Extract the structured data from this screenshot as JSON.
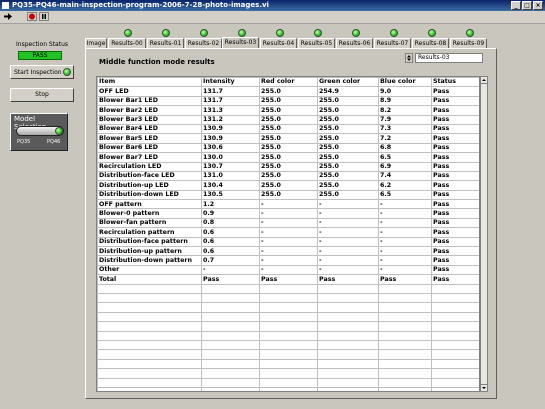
{
  "window": {
    "title": "PQ35-PQ46-main-inspection-program-2006-7-28-photo-images.vi"
  },
  "left_panel": {
    "inspection_status_label": "Inspection Status",
    "inspection_status_value": "PASS",
    "start_button_label": "Start Inspection",
    "stop_button_label": "Stop",
    "model_selection_label": "Model Selection",
    "model_options": [
      "PQ35",
      "PQ46"
    ]
  },
  "tabs": [
    {
      "label": "Image",
      "led": false
    },
    {
      "label": "Results-00",
      "led": true
    },
    {
      "label": "Results-01",
      "led": true
    },
    {
      "label": "Results-02",
      "led": true
    },
    {
      "label": "Results-03",
      "led": true,
      "active": true
    },
    {
      "label": "Results-04",
      "led": true
    },
    {
      "label": "Results-05",
      "led": true
    },
    {
      "label": "Results-06",
      "led": true
    },
    {
      "label": "Results-07",
      "led": true
    },
    {
      "label": "Results-08",
      "led": true
    },
    {
      "label": "Results-09",
      "led": true
    }
  ],
  "results": {
    "title": "Middle function mode results",
    "selector_value": "Results-03",
    "columns": [
      "Item",
      "Intensity",
      "Red color",
      "Green color",
      "Blue color",
      "Status"
    ],
    "rows": [
      [
        "OFF LED",
        "131.7",
        "255.0",
        "254.9",
        "9.0",
        "Pass"
      ],
      [
        "Blower Bar1 LED",
        "131.7",
        "255.0",
        "255.0",
        "8.9",
        "Pass"
      ],
      [
        "Blower Bar2 LED",
        "131.3",
        "255.0",
        "255.0",
        "8.2",
        "Pass"
      ],
      [
        "Blower Bar3 LED",
        "131.2",
        "255.0",
        "255.0",
        "7.9",
        "Pass"
      ],
      [
        "Blower Bar4 LED",
        "130.9",
        "255.0",
        "255.0",
        "7.3",
        "Pass"
      ],
      [
        "Blower Bar5 LED",
        "130.9",
        "255.0",
        "255.0",
        "7.2",
        "Pass"
      ],
      [
        "Blower Bar6 LED",
        "130.6",
        "255.0",
        "255.0",
        "6.8",
        "Pass"
      ],
      [
        "Blower Bar7 LED",
        "130.0",
        "255.0",
        "255.0",
        "6.5",
        "Pass"
      ],
      [
        "Recirculation LED",
        "130.7",
        "255.0",
        "255.0",
        "6.9",
        "Pass"
      ],
      [
        "Distribution-face LED",
        "131.0",
        "255.0",
        "255.0",
        "7.4",
        "Pass"
      ],
      [
        "Distribution-up LED",
        "130.4",
        "255.0",
        "255.0",
        "6.2",
        "Pass"
      ],
      [
        "Distribution-down LED",
        "130.5",
        "255.0",
        "255.0",
        "6.5",
        "Pass"
      ],
      [
        "OFF pattern",
        "1.2",
        "-",
        "-",
        "-",
        "Pass"
      ],
      [
        "Blower-0 pattern",
        "0.9",
        "-",
        "-",
        "-",
        "Pass"
      ],
      [
        "Blower-fan pattern",
        "0.8",
        "-",
        "-",
        "-",
        "Pass"
      ],
      [
        "Recirculation pattern",
        "0.6",
        "-",
        "-",
        "-",
        "Pass"
      ],
      [
        "Distribution-face pattern",
        "0.6",
        "-",
        "-",
        "-",
        "Pass"
      ],
      [
        "Distribution-up pattern",
        "0.6",
        "-",
        "-",
        "-",
        "Pass"
      ],
      [
        "Distribution-down pattern",
        "0.7",
        "-",
        "-",
        "-",
        "Pass"
      ],
      [
        "Other",
        "-",
        "-",
        "-",
        "-",
        "Pass"
      ],
      [
        "Total",
        "Pass",
        "Pass",
        "Pass",
        "Pass",
        "Pass"
      ]
    ],
    "empty_rows": 12
  },
  "colors": {
    "pass_green": "#22c322",
    "led_green": "#39c739",
    "titlebar": "#0a246a"
  }
}
